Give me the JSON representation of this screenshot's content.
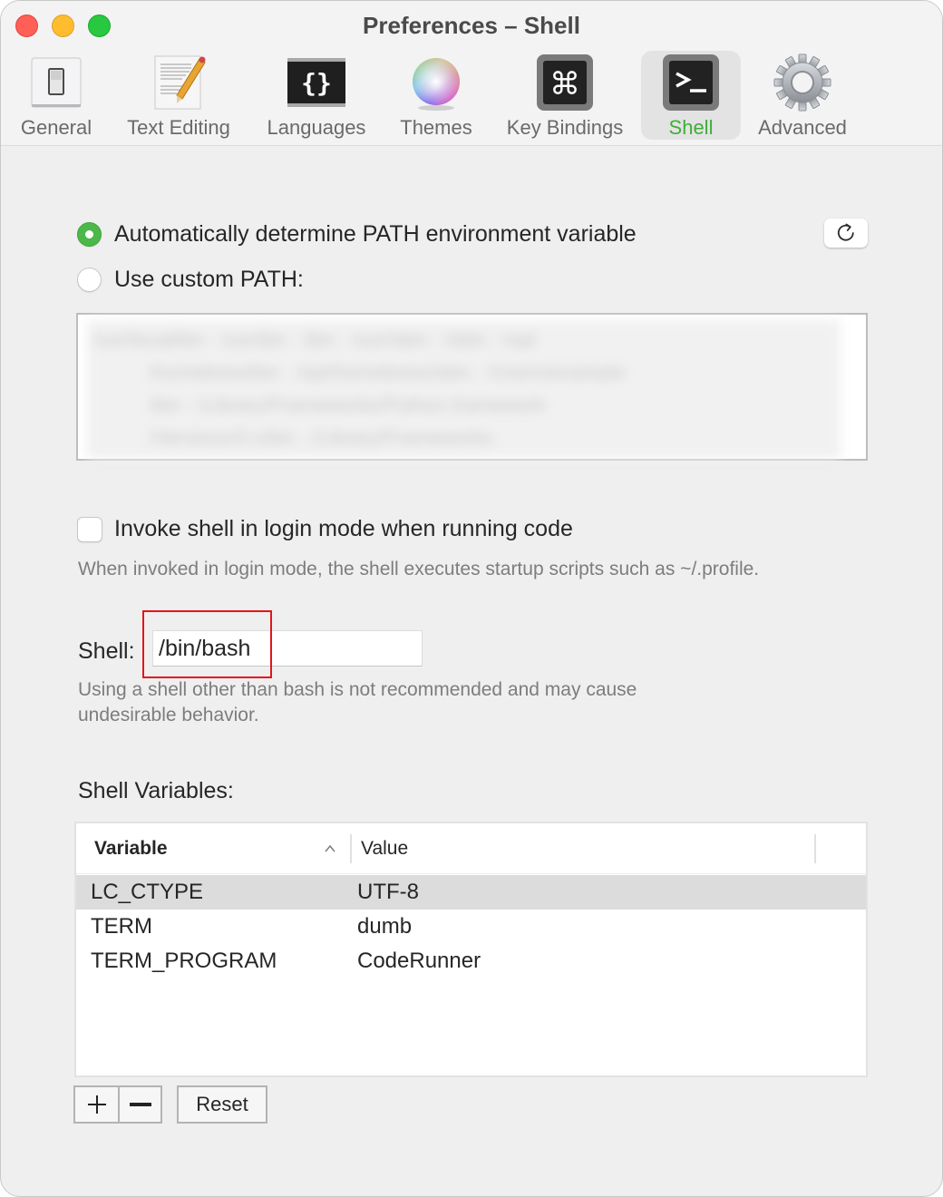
{
  "window": {
    "title": "Preferences – Shell"
  },
  "toolbar": {
    "items": [
      {
        "label": "General",
        "icon": "toggle-switch-icon",
        "active": false
      },
      {
        "label": "Text Editing",
        "icon": "document-pencil-icon",
        "active": false
      },
      {
        "label": "Languages",
        "icon": "curly-braces-icon",
        "active": false
      },
      {
        "label": "Themes",
        "icon": "color-wheel-icon",
        "active": false
      },
      {
        "label": "Key Bindings",
        "icon": "command-key-icon",
        "active": false
      },
      {
        "label": "Shell",
        "icon": "terminal-prompt-icon",
        "active": true
      },
      {
        "label": "Advanced",
        "icon": "gear-icon",
        "active": false
      }
    ],
    "active_color": "#3fae3a"
  },
  "path": {
    "auto_label": "Automatically determine PATH environment variable",
    "custom_label": "Use custom PATH:",
    "selected": "auto",
    "value_lines": [
      "/usr/local/bin : /usr/bin : /bin : /usr/sbin : /sbin : /opt",
      "/homebrew/bin : /opt/homebrew/sbin : /Users/example",
      "/bin : /Library/Frameworks/Python.framework",
      "/Versions/3.x/bin : /Library/Frameworks"
    ],
    "refresh_icon": "refresh-icon"
  },
  "login_mode": {
    "label": "Invoke shell in login mode when running code",
    "checked": false,
    "help": "When invoked in login mode, the shell executes startup scripts such as ~/.profile."
  },
  "shell": {
    "label": "Shell:",
    "value": "/bin/bash",
    "help_line1": "Using a shell other than bash is not recommended and may cause",
    "help_line2": "undesirable behavior."
  },
  "variables": {
    "label": "Shell Variables:",
    "columns": {
      "variable": "Variable",
      "value": "Value"
    },
    "sort": "ascending",
    "rows": [
      {
        "variable": "LC_CTYPE",
        "value": "UTF-8",
        "selected": true
      },
      {
        "variable": "TERM",
        "value": "dumb",
        "selected": false
      },
      {
        "variable": "TERM_PROGRAM",
        "value": "CodeRunner",
        "selected": false
      }
    ],
    "add_icon": "plus-icon",
    "remove_icon": "minus-icon",
    "reset_label": "Reset"
  }
}
